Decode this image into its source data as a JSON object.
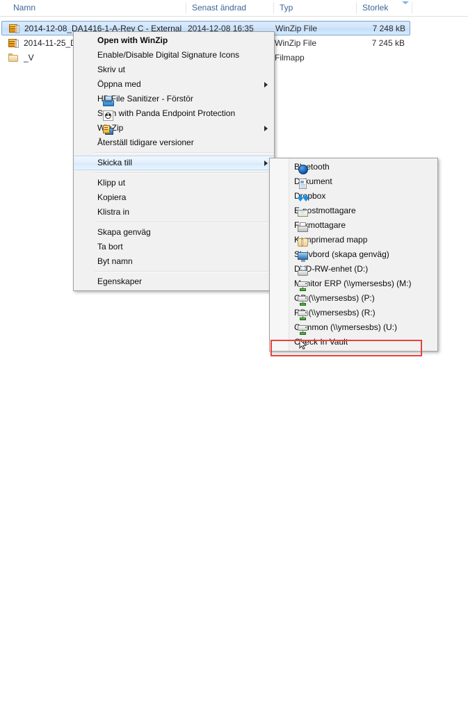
{
  "explorer": {
    "columns": [
      {
        "label": "Namn"
      },
      {
        "label": "Senast ändrad"
      },
      {
        "label": "Typ"
      },
      {
        "label": "Storlek"
      }
    ],
    "sort_column": "Storlek",
    "sort_direction": "descending",
    "rows": [
      {
        "name": "2014-12-08_DA1416-1-A-Rev C - External",
        "modified": "2014-12-08 16:35",
        "type": "WinZip File",
        "size": "7 248 kB",
        "icon": "winzip-file-icon",
        "selected": true
      },
      {
        "name": "2014-11-25_D",
        "modified": "",
        "type": "WinZip File",
        "size": "7 245 kB",
        "icon": "winzip-file-icon",
        "selected": false
      },
      {
        "name": "_V",
        "modified": "",
        "type": "Filmapp",
        "size": "",
        "icon": "folder-icon",
        "selected": false
      }
    ]
  },
  "context_menu": {
    "items": [
      {
        "label": "Open with WinZip",
        "bold": true,
        "icon": null,
        "submenu": false
      },
      {
        "label": "Enable/Disable Digital Signature Icons",
        "bold": false,
        "icon": null,
        "submenu": false
      },
      {
        "label": "Skriv ut",
        "bold": false,
        "icon": null,
        "submenu": false
      },
      {
        "label": "Öppna med",
        "bold": false,
        "icon": null,
        "submenu": true
      },
      {
        "label": "HP File Sanitizer - Förstör",
        "bold": false,
        "icon": "shredder-icon",
        "submenu": false
      },
      {
        "label": "Scan with Panda Endpoint Protection",
        "bold": false,
        "icon": "panda-icon",
        "submenu": false
      },
      {
        "label": "WinZip",
        "bold": false,
        "icon": "winzip-icon",
        "submenu": true
      },
      {
        "label": "Återställ tidigare versioner",
        "bold": false,
        "icon": null,
        "submenu": false
      },
      {
        "separator": true
      },
      {
        "label": "Skicka till",
        "bold": false,
        "icon": null,
        "submenu": true,
        "highlighted": true
      },
      {
        "separator": true
      },
      {
        "label": "Klipp ut",
        "bold": false,
        "icon": null,
        "submenu": false
      },
      {
        "label": "Kopiera",
        "bold": false,
        "icon": null,
        "submenu": false
      },
      {
        "label": "Klistra in",
        "bold": false,
        "icon": null,
        "submenu": false
      },
      {
        "separator": true
      },
      {
        "label": "Skapa genväg",
        "bold": false,
        "icon": null,
        "submenu": false
      },
      {
        "label": "Ta bort",
        "bold": false,
        "icon": null,
        "submenu": false
      },
      {
        "label": "Byt namn",
        "bold": false,
        "icon": null,
        "submenu": false
      },
      {
        "separator": true
      },
      {
        "label": "Egenskaper",
        "bold": false,
        "icon": null,
        "submenu": false
      }
    ]
  },
  "send_to_submenu": {
    "items": [
      {
        "label": "Bluetooth",
        "icon": "bluetooth-icon"
      },
      {
        "label": "Dokument",
        "icon": "document-icon"
      },
      {
        "label": "Dropbox",
        "icon": "dropbox-icon"
      },
      {
        "label": "E-postmottagare",
        "icon": "mail-icon"
      },
      {
        "label": "Faxmottagare",
        "icon": "fax-icon"
      },
      {
        "label": "Komprimerad mapp",
        "icon": "zipped-folder-icon"
      },
      {
        "label": "Skrivbord (skapa genväg)",
        "icon": "desktop-icon"
      },
      {
        "label": "DVD-RW-enhet (D:)",
        "icon": "dvd-drive-icon"
      },
      {
        "label": "Monitor ERP (\\\\ymersesbs) (M:)",
        "icon": "network-drive-icon"
      },
      {
        "label": "OP (\\\\ymersesbs) (P:)",
        "icon": "network-drive-icon"
      },
      {
        "label": "RD (\\\\ymersesbs) (R:)",
        "icon": "network-drive-icon"
      },
      {
        "label": "Common (\\\\ymersesbs) (U:)",
        "icon": "network-drive-icon"
      },
      {
        "label": "Check In Vault",
        "icon": "cursor-icon",
        "annotated": true
      }
    ]
  },
  "annotation": {
    "highlight_color": "#e8413a",
    "target_label": "Check In Vault"
  }
}
